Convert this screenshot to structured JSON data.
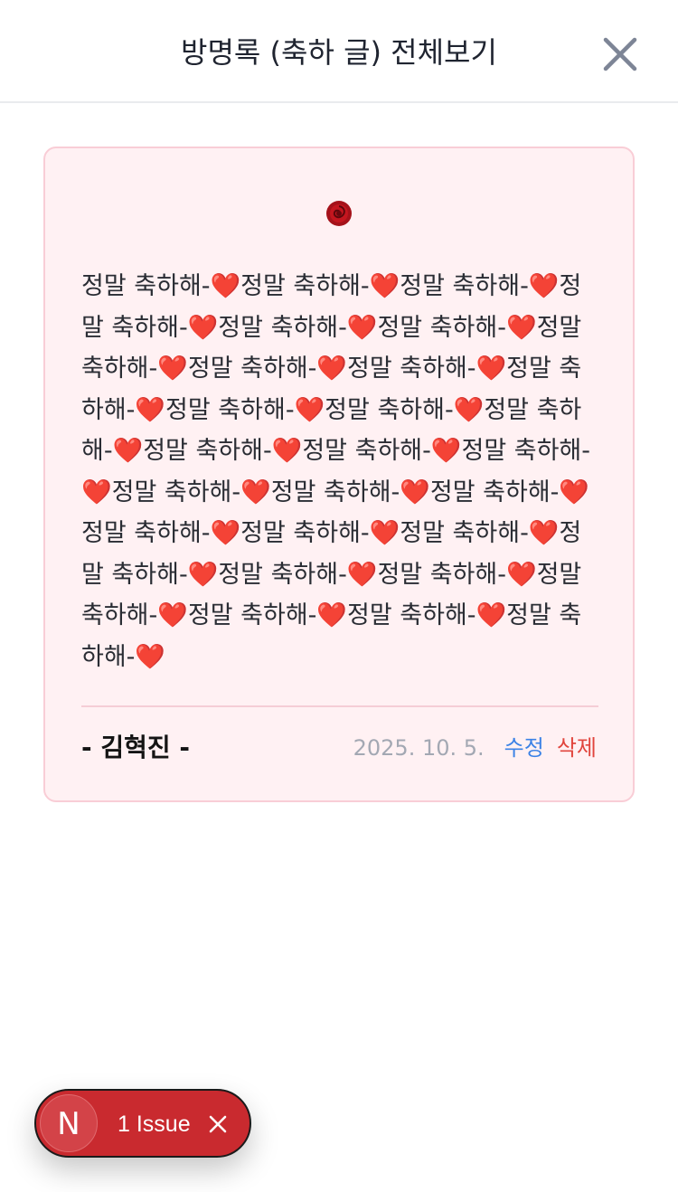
{
  "header": {
    "title": "방명록 (축하 글) 전체보기",
    "close_icon": "close-icon"
  },
  "guestbook_entry": {
    "icon": "rose-icon",
    "message": "정말 축하해-❤️정말 축하해-❤️정말 축하해-❤️정말 축하해-❤️정말 축하해-❤️정말 축하해-❤️정말 축하해-❤️정말 축하해-❤️정말 축하해-❤️정말 축하해-❤️정말 축하해-❤️정말 축하해-❤️정말 축하해-❤️정말 축하해-❤️정말 축하해-❤️정말 축하해-❤️정말 축하해-❤️정말 축하해-❤️정말 축하해-❤️정말 축하해-❤️정말 축하해-❤️정말 축하해-❤️정말 축하해-❤️정말 축하해-❤️정말 축하해-❤️정말 축하해-❤️정말 축하해-❤️정말 축하해-❤️정말 축하해-❤️",
    "author": "- 김혁진 -",
    "date": "2025. 10. 5.",
    "edit_label": "수정",
    "delete_label": "삭제"
  },
  "dev_indicator": {
    "logo_letter": "N",
    "label": "1 Issue",
    "close_icon": "close-icon"
  },
  "colors": {
    "card_background": "#fff1f3",
    "card_border": "#f9cdd6",
    "edit": "#3b82e6",
    "delete": "#e1453d",
    "date": "#a3a8b3",
    "issue_pill": "#c92a2f"
  }
}
